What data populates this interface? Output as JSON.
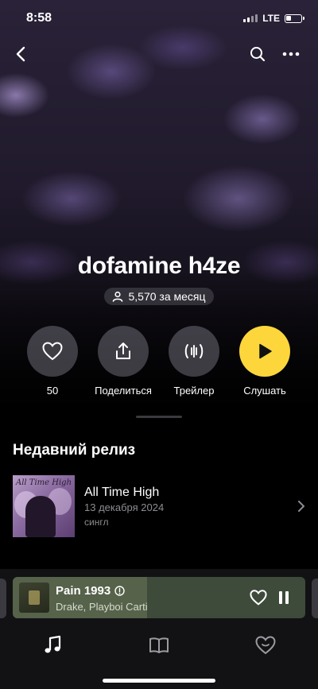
{
  "status_bar": {
    "time": "8:58",
    "network": "LTE"
  },
  "artist": {
    "name": "dofamine h4ze",
    "monthly_listeners": "5,570 за месяц"
  },
  "actions": [
    {
      "label": "50",
      "icon": "heart-icon"
    },
    {
      "label": "Поделиться",
      "icon": "share-icon"
    },
    {
      "label": "Трейлер",
      "icon": "trailer-wave-icon"
    },
    {
      "label": "Слушать",
      "icon": "play-icon"
    }
  ],
  "recent_release": {
    "section_title": "Недавний релиз",
    "title": "All Time High",
    "date": "13 декабря 2024",
    "type": "сингл",
    "cover_text": "All Time High"
  },
  "mini_player": {
    "track": "Pain 1993",
    "artists": "Drake, Playboi Carti",
    "progress": 0.46
  },
  "tabs": [
    {
      "name": "music-tab",
      "icon": "music-note-icon",
      "active": true
    },
    {
      "name": "library-tab",
      "icon": "book-icon",
      "active": false
    },
    {
      "name": "favorites-tab",
      "icon": "heart-outline-icon",
      "active": false
    }
  ],
  "colors": {
    "accent": "#fdd63c",
    "background": "#000000",
    "mini_player": "#3e4a3a",
    "secondary_text": "#8d8d92"
  }
}
